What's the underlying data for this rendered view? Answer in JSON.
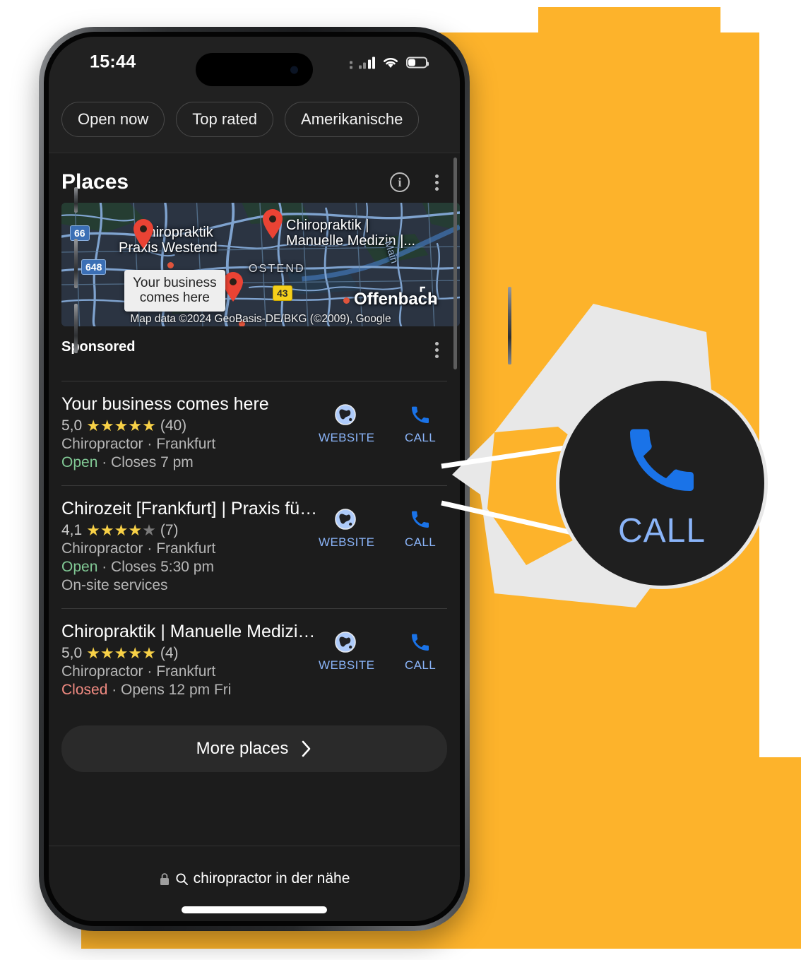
{
  "colors": {
    "orange": "#FDB32B",
    "accent_blue": "#8ab4f8",
    "phone_blue": "#1a73e8",
    "star": "#f8d147",
    "open_green": "#81c995",
    "closed_red": "#f28b82",
    "screen_bg": "#1c1c1c",
    "chip_bg": "#212121"
  },
  "status_bar": {
    "time": "15:44",
    "signal_icon": "cellular-signal-icon",
    "wifi_icon": "wifi-icon",
    "battery_icon": "battery-icon",
    "battery_level_pct": 40
  },
  "chips": [
    {
      "label": "Open now",
      "name": "chip-open-now"
    },
    {
      "label": "Top rated",
      "name": "chip-top-rated"
    },
    {
      "label": "Amerikanische",
      "name": "chip-amerikanische"
    }
  ],
  "places_panel": {
    "title": "Places",
    "info_icon": "info-icon",
    "kebab_icon": "more-options-icon",
    "sponsored_label": "Sponsored",
    "sponsored_kebab_icon": "more-options-icon"
  },
  "map": {
    "attribution": "Map data ©2024 GeoBasis-DE/BKG (©2009), Google",
    "expand_icon": "expand-map-icon",
    "tooltip": {
      "line1": "Your business",
      "line2": "comes here"
    },
    "labels": [
      {
        "text": "Chiropraktik",
        "name": "map-label-chiropraktik-westend-1"
      },
      {
        "text": "Praxis Westend",
        "name": "map-label-chiropraktik-westend-2"
      },
      {
        "text": "Chiropraktik |",
        "name": "map-label-manuelle-1"
      },
      {
        "text": "Manuelle Medizin |...",
        "name": "map-label-manuelle-2"
      },
      {
        "text": "OSTEND",
        "name": "map-label-ostend"
      },
      {
        "text": "Offenbach",
        "name": "map-label-offenbach"
      },
      {
        "text": "Main",
        "name": "map-label-main-river"
      }
    ],
    "road_shields": [
      {
        "number": "66",
        "type": "blue"
      },
      {
        "number": "648",
        "type": "blue"
      },
      {
        "number": "43",
        "type": "yellow"
      }
    ],
    "pins": 3
  },
  "listings": [
    {
      "name": "Your business comes here",
      "rating": "5,0",
      "stars_filled": 5,
      "review_count": "(40)",
      "category": "Chiropractor · Frankfurt",
      "status": "Open",
      "status_state": "open",
      "hours": "Closes 7 pm",
      "extra": "",
      "website_label": "WEBSITE",
      "call_label": "CALL",
      "website_icon": "globe-icon",
      "call_icon": "phone-icon"
    },
    {
      "name": "Chirozeit [Frankfurt] | Praxis für...",
      "rating": "4,1",
      "stars_filled": 4,
      "review_count": "(7)",
      "category": "Chiropractor · Frankfurt",
      "status": "Open",
      "status_state": "open",
      "hours": "Closes 5:30 pm",
      "extra": "On-site services",
      "website_label": "WEBSITE",
      "call_label": "CALL",
      "website_icon": "globe-icon",
      "call_icon": "phone-icon"
    },
    {
      "name": "Chiropraktik | Manuelle Medizin ...",
      "rating": "5,0",
      "stars_filled": 5,
      "review_count": "(4)",
      "category": "Chiropractor · Frankfurt",
      "status": "Closed",
      "status_state": "closed",
      "hours": "Opens 12 pm Fri",
      "extra": "",
      "website_label": "WEBSITE",
      "call_label": "CALL",
      "website_icon": "globe-icon",
      "call_icon": "phone-icon"
    }
  ],
  "more_places": {
    "label": "More places",
    "chevron_icon": "chevron-right-icon"
  },
  "bottom_bar": {
    "lock_icon": "lock-icon",
    "search_icon": "search-icon",
    "query": "chiropractor in der nähe",
    "home_indicator": "home-indicator"
  },
  "magnifier": {
    "label": "CALL",
    "icon": "phone-icon"
  }
}
